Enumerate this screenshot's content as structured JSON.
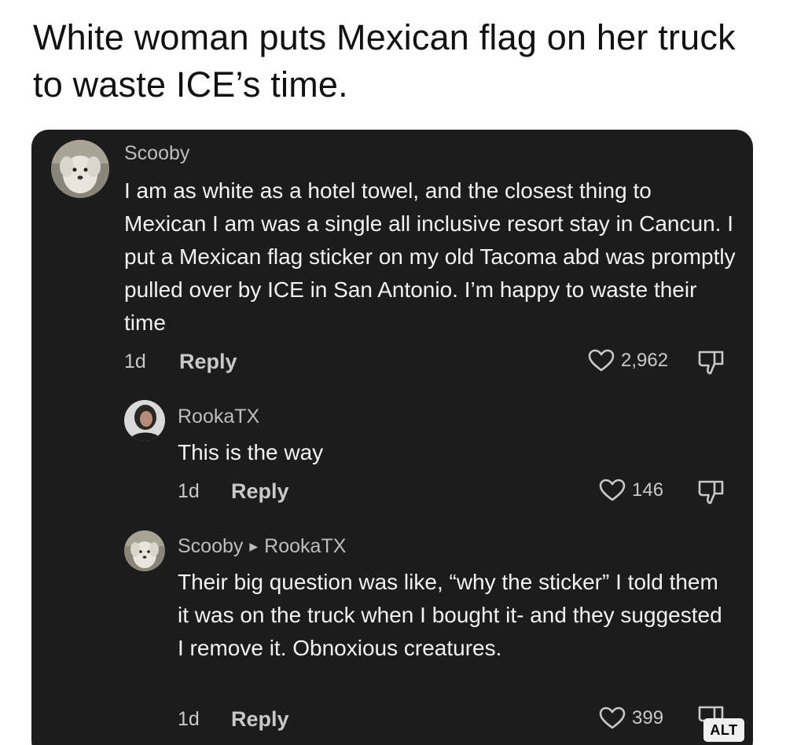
{
  "post": {
    "title": "White woman puts Mexican flag on her truck to waste ICE’s time."
  },
  "comments": [
    {
      "username": "Scooby",
      "avatar": "white-dog-avatar",
      "text": "I am as white as a hotel towel, and the closest thing to Mexican I am was a single all inclusive resort stay in Cancun. I put a Mexican flag sticker on my old Tacoma abd was promptly pulled over by ICE in San Antonio. I’m happy to waste their time",
      "time": "1d",
      "reply_label": "Reply",
      "likes": "2,962"
    },
    {
      "username": "RookaTX",
      "avatar": "person-avatar",
      "text": "This is the way",
      "time": "1d",
      "reply_label": "Reply",
      "likes": "146"
    },
    {
      "username": "Scooby",
      "reply_to": "RookaTX",
      "avatar": "white-dog-avatar",
      "text": "Their big question was like, “why the sticker” I told them it was on the truck when I bought it- and they suggested I remove it. Obnoxious creatures.",
      "time": "1d",
      "reply_label": "Reply",
      "likes": "399"
    }
  ],
  "alt_badge": "ALT",
  "icons": {
    "like": "heart-outline-icon",
    "dislike": "thumbs-down-icon",
    "reply_arrow": "triangle-right-icon"
  },
  "colors": {
    "card_background": "#1c1c1c",
    "text_primary": "#f2f2f2",
    "text_secondary": "#bdbdbd"
  }
}
